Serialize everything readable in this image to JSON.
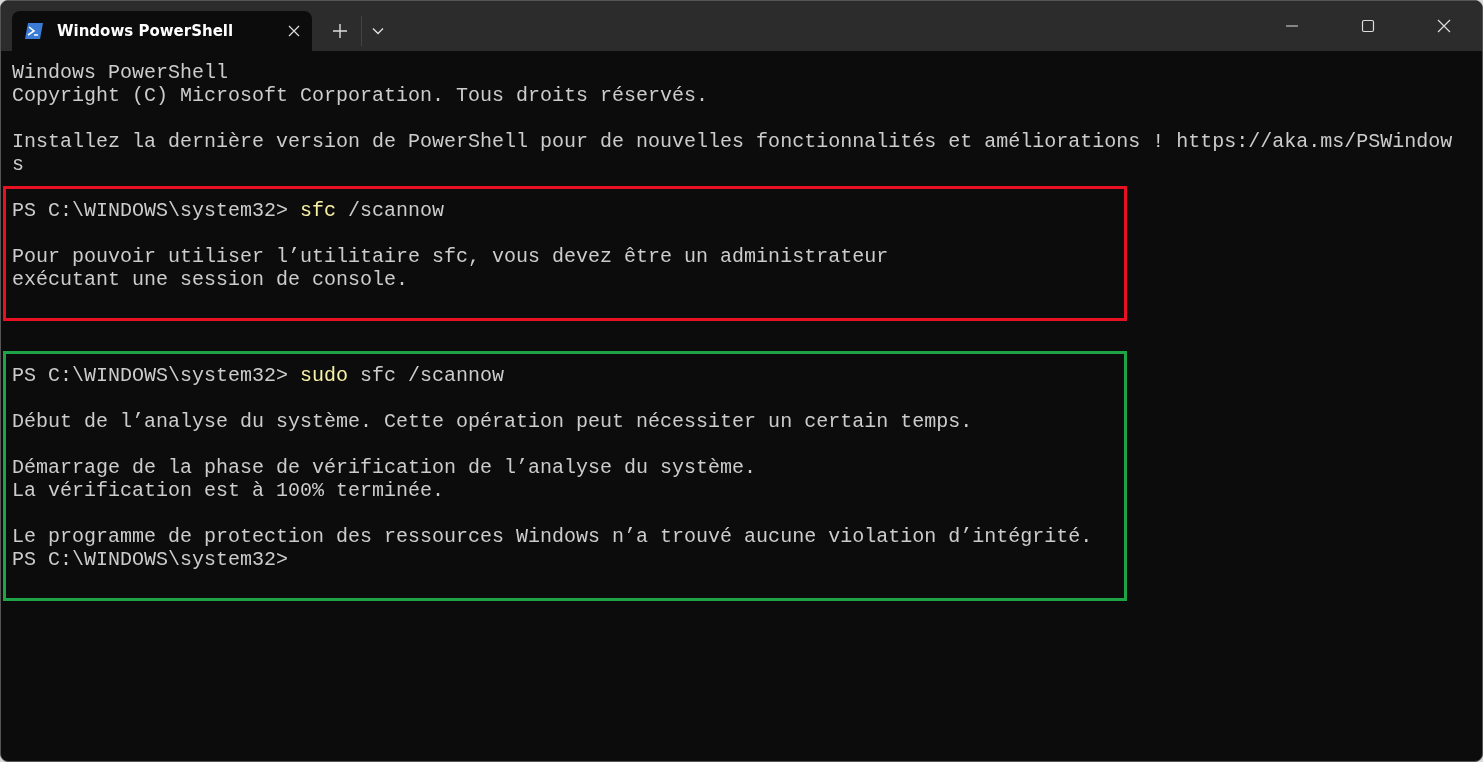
{
  "tab": {
    "title": "Windows PowerShell",
    "selected": true
  },
  "sections": [
    {
      "lines": [
        {
          "kind": "text",
          "text": "Windows PowerShell"
        },
        {
          "kind": "text",
          "text": "Copyright (C) Microsoft Corporation. Tous droits réservés."
        },
        {
          "kind": "blank"
        },
        {
          "kind": "text",
          "text": "Installez la dernière version de PowerShell pour de nouvelles fonctionnalités et améliorations ! https://aka.ms/PSWindow"
        },
        {
          "kind": "text",
          "text": "s"
        }
      ]
    },
    {
      "color": "#e81123",
      "lines": [
        {
          "kind": "prompt",
          "prompt": "PS C:\\WINDOWS\\system32>",
          "command": "sfc",
          "args": "/scannow"
        },
        {
          "kind": "blank"
        },
        {
          "kind": "text",
          "text": "Pour pouvoir utiliser l’utilitaire sfc, vous devez être un administrateur"
        },
        {
          "kind": "text",
          "text": "exécutant une session de console."
        }
      ]
    },
    {
      "color": "#1ea446",
      "lines": [
        {
          "kind": "prompt",
          "prompt": "PS C:\\WINDOWS\\system32>",
          "command": "sudo",
          "args": "sfc /scannow"
        },
        {
          "kind": "blank"
        },
        {
          "kind": "text",
          "text": "Début de l’analyse du système. Cette opération peut nécessiter un certain temps."
        },
        {
          "kind": "blank"
        },
        {
          "kind": "text",
          "text": "Démarrage de la phase de vérification de l’analyse du système."
        },
        {
          "kind": "text",
          "text": "La vérification est à 100% terminée."
        },
        {
          "kind": "blank"
        },
        {
          "kind": "text",
          "text": "Le programme de protection des ressources Windows n’a trouvé aucune violation d’intégrité."
        },
        {
          "kind": "prompt",
          "prompt": "PS C:\\WINDOWS\\system32>"
        }
      ]
    }
  ]
}
